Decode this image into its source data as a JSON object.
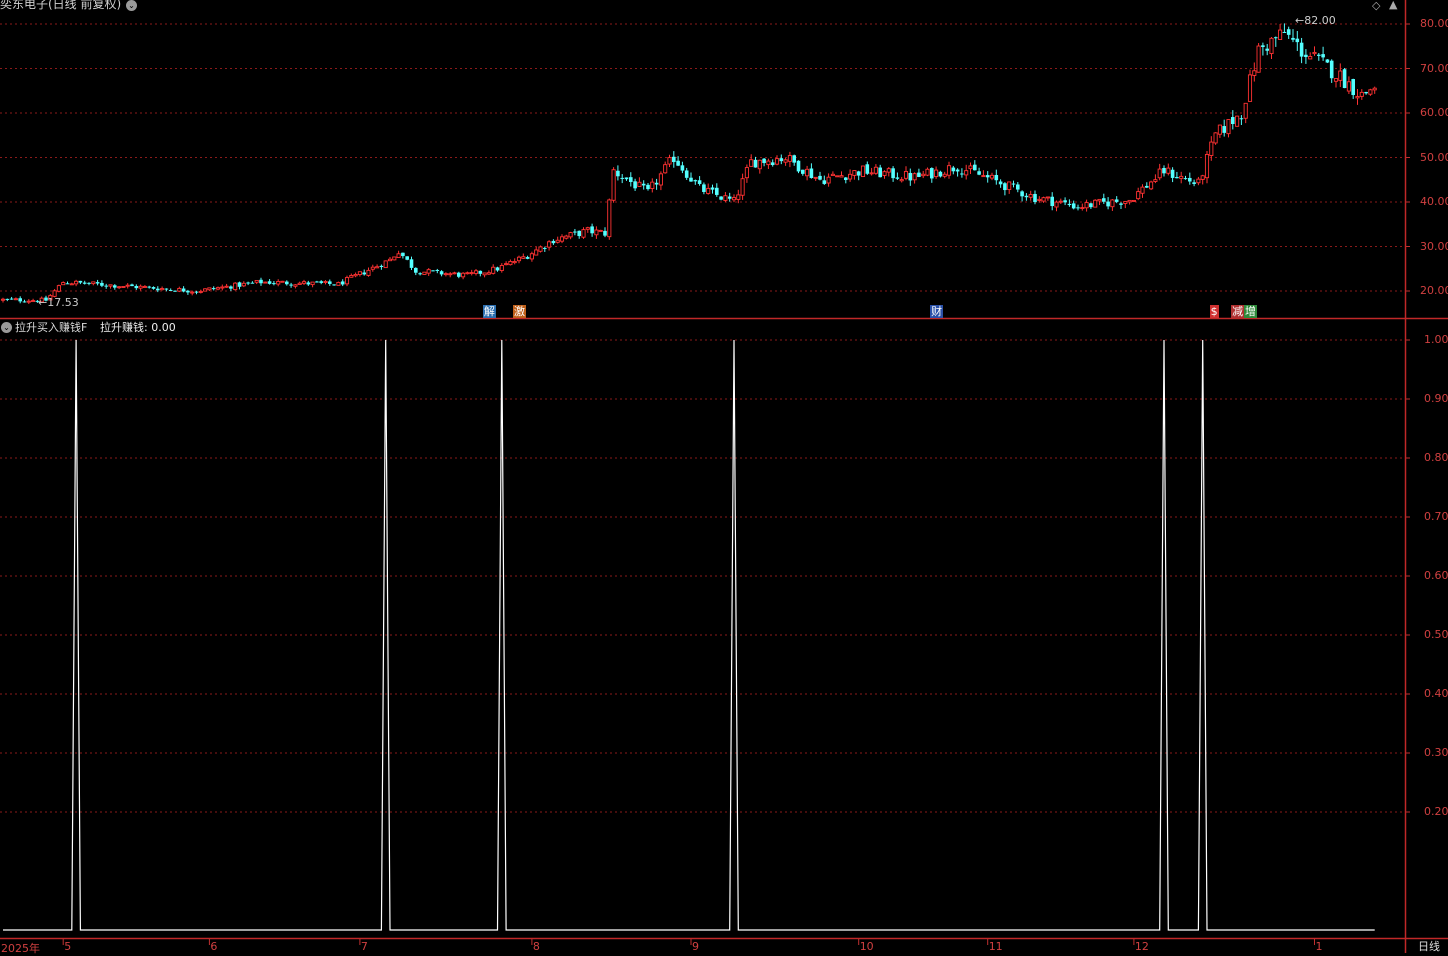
{
  "header": {
    "stock_title": "奕东电子(日线 前复权)",
    "indicator_title": "拉升买入赚钱F",
    "indicator_value_label": "拉升赚钱: 0.00"
  },
  "price_axis_labels": [
    "80.00",
    "70.00",
    "60.00",
    "50.00",
    "40.00",
    "30.00",
    "20.00"
  ],
  "indicator_axis_labels": [
    "1.00",
    "0.90",
    "0.80",
    "0.70",
    "0.60",
    "0.50",
    "0.40",
    "0.30",
    "0.20"
  ],
  "date_labels": [
    {
      "text": "2025年",
      "key": "start"
    },
    {
      "text": "5",
      "key": "5"
    },
    {
      "text": "6",
      "key": "6"
    },
    {
      "text": "7",
      "key": "7"
    },
    {
      "text": "8",
      "key": "8"
    },
    {
      "text": "9",
      "key": "9"
    },
    {
      "text": "10",
      "key": "10"
    },
    {
      "text": "11",
      "key": "11"
    },
    {
      "text": "12",
      "key": "12"
    },
    {
      "text": "1",
      "key": "1"
    }
  ],
  "period_label": "日线",
  "annotations": {
    "low_price": "17.53",
    "high_price": "82.00"
  },
  "event_markers": [
    {
      "text": "解",
      "color": "#2b6fb0",
      "index": 113
    },
    {
      "text": "激",
      "color": "#c0601a",
      "index": 120
    },
    {
      "text": "财",
      "color": "#2a50a8",
      "index": 217
    },
    {
      "text": "$",
      "color": "#d03030",
      "index": 282
    },
    {
      "text": "减",
      "color": "#b03030",
      "index": 287
    },
    {
      "text": "增",
      "color": "#2e8a3a",
      "index": 290
    }
  ],
  "colors": {
    "up": "#ff3232",
    "down": "#54ffff",
    "grid": "#8a1a1a",
    "indicator_line": "#ffffff",
    "axis_text": "#d04040"
  },
  "chart_data": [
    {
      "type": "candlestick",
      "title": "奕东电子(日线 前复权)",
      "ylim": [
        15,
        84
      ],
      "x_labels": [
        "2025年",
        "5",
        "6",
        "7",
        "8",
        "9",
        "10",
        "11",
        "12",
        "1"
      ],
      "anchors": [
        [
          0,
          18.0
        ],
        [
          10,
          17.9
        ],
        [
          14,
          22.0
        ],
        [
          30,
          21.0
        ],
        [
          45,
          20.0
        ],
        [
          60,
          22.0
        ],
        [
          78,
          21.5
        ],
        [
          90,
          27.0
        ],
        [
          92,
          29.0
        ],
        [
          96,
          24.5
        ],
        [
          108,
          23.5
        ],
        [
          115,
          25.0
        ],
        [
          122,
          28.0
        ],
        [
          128,
          31.5
        ],
        [
          136,
          33.5
        ],
        [
          140,
          33.0
        ],
        [
          142,
          47.0
        ],
        [
          150,
          42.0
        ],
        [
          156,
          50.0
        ],
        [
          162,
          43.0
        ],
        [
          170,
          40.0
        ],
        [
          174,
          49.0
        ],
        [
          182,
          50.0
        ],
        [
          190,
          45.0
        ],
        [
          200,
          47.0
        ],
        [
          212,
          45.5
        ],
        [
          222,
          48.0
        ],
        [
          230,
          45.0
        ],
        [
          240,
          41.0
        ],
        [
          250,
          39.0
        ],
        [
          262,
          40.5
        ],
        [
          270,
          47.0
        ],
        [
          278,
          44.0
        ],
        [
          282,
          55.0
        ],
        [
          288,
          60.0
        ],
        [
          292,
          74.0
        ],
        [
          298,
          78.0
        ],
        [
          302,
          74.0
        ],
        [
          310,
          69.0
        ],
        [
          316,
          64.0
        ],
        [
          319,
          66.0
        ]
      ]
    },
    {
      "type": "line",
      "title": "拉升买入赚钱F",
      "ylim": [
        0,
        1.04
      ],
      "baseline": 0,
      "spike_indices": [
        17,
        89,
        116,
        170,
        270,
        279
      ],
      "spike_value": 1.0,
      "bars": 319
    }
  ]
}
